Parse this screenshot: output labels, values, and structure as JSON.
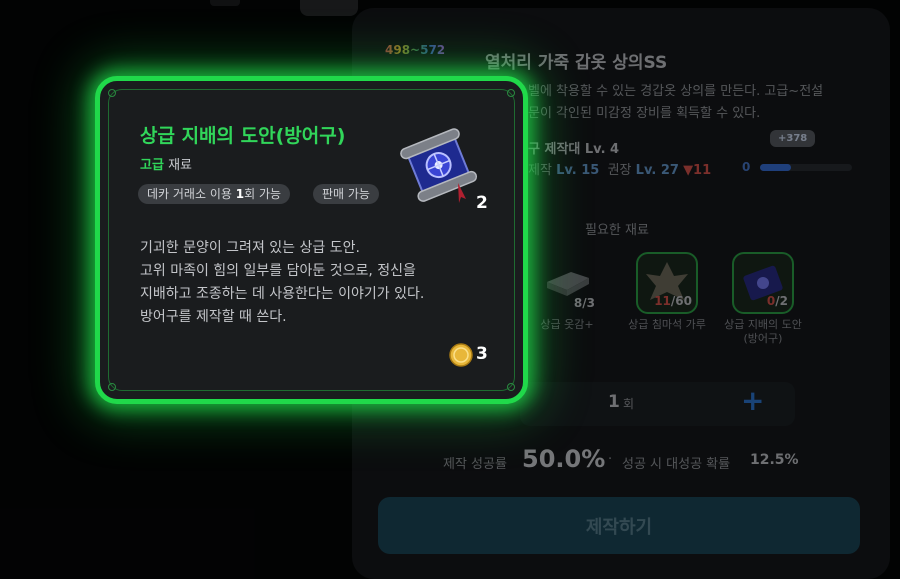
{
  "craft": {
    "level_range": "498~572",
    "title": "열처리 가죽 갑옷 상의SS",
    "desc_line1": "벨에 착용할 수 있는 경갑옷 상의를 만든다. 고급~전설",
    "desc_line2": "문이 각인된 미감정 장비를 획득할 수 있다.",
    "workbench": "구 제작대 Lv. 4",
    "stats_prefix": "제작",
    "craft_level": "Lv. 15",
    "recommended_label": "권장",
    "recommended_level": "Lv. 27",
    "recommended_diff": "▼11",
    "exp_value": "0",
    "exp_gain": "+378",
    "exp_progress": 0.34
  },
  "materials": {
    "label": "필요한 재료",
    "items": [
      {
        "name": "상급 옷감+",
        "have": "8",
        "need": "/3",
        "short": false
      },
      {
        "name": "상급 침마석 가루",
        "have": "11",
        "need": "/60",
        "short": true
      },
      {
        "name": "상급 지배의 도안(방어구)",
        "have": "0",
        "need": "/2",
        "short": true
      }
    ]
  },
  "quantity": {
    "value": "1",
    "unit": "회"
  },
  "rates": {
    "success_label": "제작 성공률",
    "success_value": "50.0%",
    "dot": "·",
    "great_label": "성공 시 대성공 확률",
    "great_value": "12.5%"
  },
  "craft_button": "제작하기",
  "tooltip": {
    "name": "상급 지배의 도안(방어구)",
    "grade": "고급",
    "type": "재료",
    "tag_trade_prefix": "데카 거래소 이용 ",
    "tag_trade_count": "1",
    "tag_trade_suffix": "회 가능",
    "tag_sell": "판매 가능",
    "count": "2",
    "description": [
      "기괴한 문양이 그려져 있는 상급 도안.",
      "고위 마족이 힘의 일부를 담아둔 것으로, 정신을",
      "지배하고 조종하는 데 사용한다는 이야기가 있다.",
      "방어구를 제작할 때 쓴다."
    ],
    "price": "3"
  },
  "icons": [
    "scroll-item-icon",
    "gold-coin-icon",
    "cloth-material-icon",
    "leaf-material-icon",
    "plus-icon"
  ],
  "colors": {
    "glow": "#20d94a",
    "grade_green": "#31d65a",
    "accent_blue": "#2f7ad9",
    "warning_red": "#e0564f"
  }
}
